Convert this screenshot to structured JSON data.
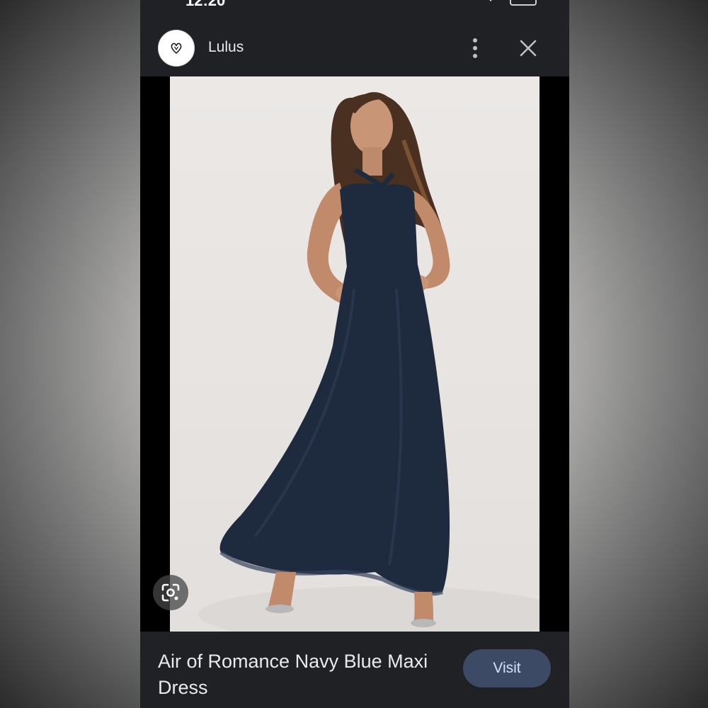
{
  "status_bar": {
    "time": "12:20"
  },
  "header": {
    "site_name": "Lulus",
    "avatar_icon": "heart-logo-icon",
    "more_icon": "more-vert-icon",
    "close_icon": "close-icon"
  },
  "image_viewer": {
    "lens_icon": "google-lens-icon"
  },
  "footer": {
    "title": "Air of Romance Navy Blue Maxi Dress",
    "visit_label": "Visit"
  },
  "colors": {
    "panel_bg": "#202124",
    "visit_bg": "#3c4a66",
    "visit_text": "#d2e3fc",
    "dress": "#1e2a3e"
  }
}
